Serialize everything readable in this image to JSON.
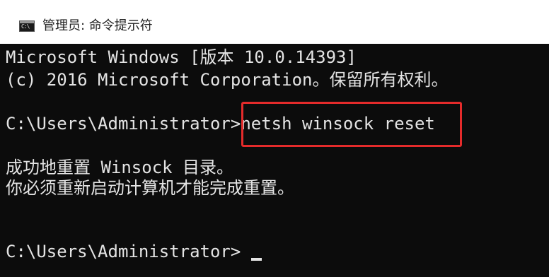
{
  "window": {
    "title": "管理员: 命令提示符",
    "icon": "cmd-icon",
    "icon_glyph": "C:\\"
  },
  "console": {
    "lines": [
      "Microsoft Windows [版本 10.0.14393]",
      "(c) 2016 Microsoft Corporation。保留所有权利。",
      "C:\\Users\\Administrator>netsh winsock reset",
      "成功地重置 Winsock 目录。",
      "你必须重新启动计算机才能完成重置。",
      "C:\\Users\\Administrator>"
    ],
    "highlighted_command": "netsh winsock reset"
  },
  "colors": {
    "console_background": "#0c0c0c",
    "console_text": "#e4e4e4",
    "highlight_border": "#e52b2b",
    "titlebar_background": "#ffffff"
  }
}
